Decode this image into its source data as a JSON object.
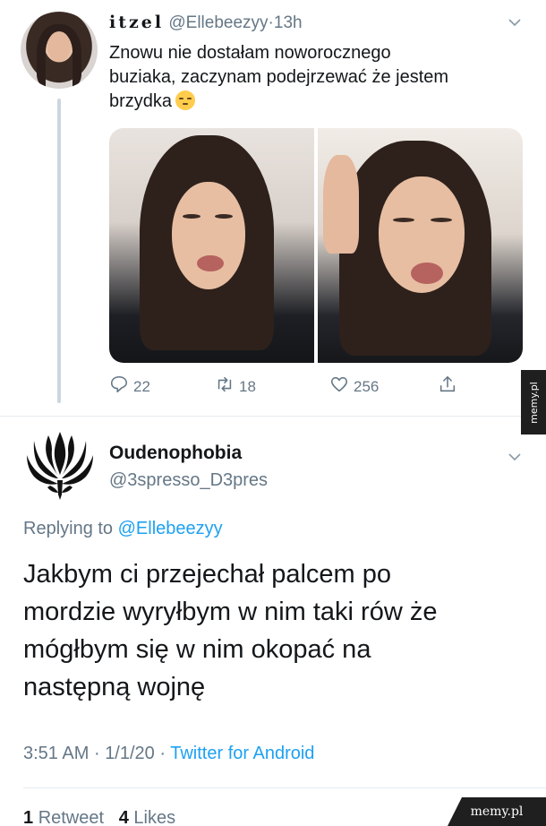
{
  "tweet1": {
    "display_name": "itzel",
    "handle": "@Ellebeezyy",
    "separator": "·",
    "time": "13h",
    "text_line1": "Znowu nie dostałam noworocznego",
    "text_line2": "buziaka, zaczynam podejrzewać że jestem",
    "text_line3": "brzydka",
    "emoji_icon": "pensive-face-emoji",
    "photo_count": 2,
    "actions": {
      "replies": "22",
      "retweets": "18",
      "likes": "256"
    }
  },
  "tweet2": {
    "display_name": "Oudenophobia",
    "handle": "@3spresso_D3pres",
    "replying_prefix": "Replying to",
    "replying_handle": "@Ellebeezyy",
    "text_line1": "Jakbym ci przejechał palcem po",
    "text_line2": "mordzie wyryłbym w nim taki rów że",
    "text_line3": "mógłbym się w nim okopać na",
    "text_line4": "następną wojnę",
    "time": "3:51 AM",
    "date": "1/1/20",
    "separator": "·",
    "client": "Twitter for Android",
    "retweet_count": "1",
    "retweet_label": "Retweet",
    "like_count": "4",
    "like_label": "Likes"
  },
  "watermark": {
    "side": "memy.pl",
    "bottom": "memy.pl"
  },
  "colors": {
    "link": "#1da1f2",
    "secondary_text": "#657786",
    "primary_text": "#14171a",
    "divider": "#e6ecf0"
  }
}
